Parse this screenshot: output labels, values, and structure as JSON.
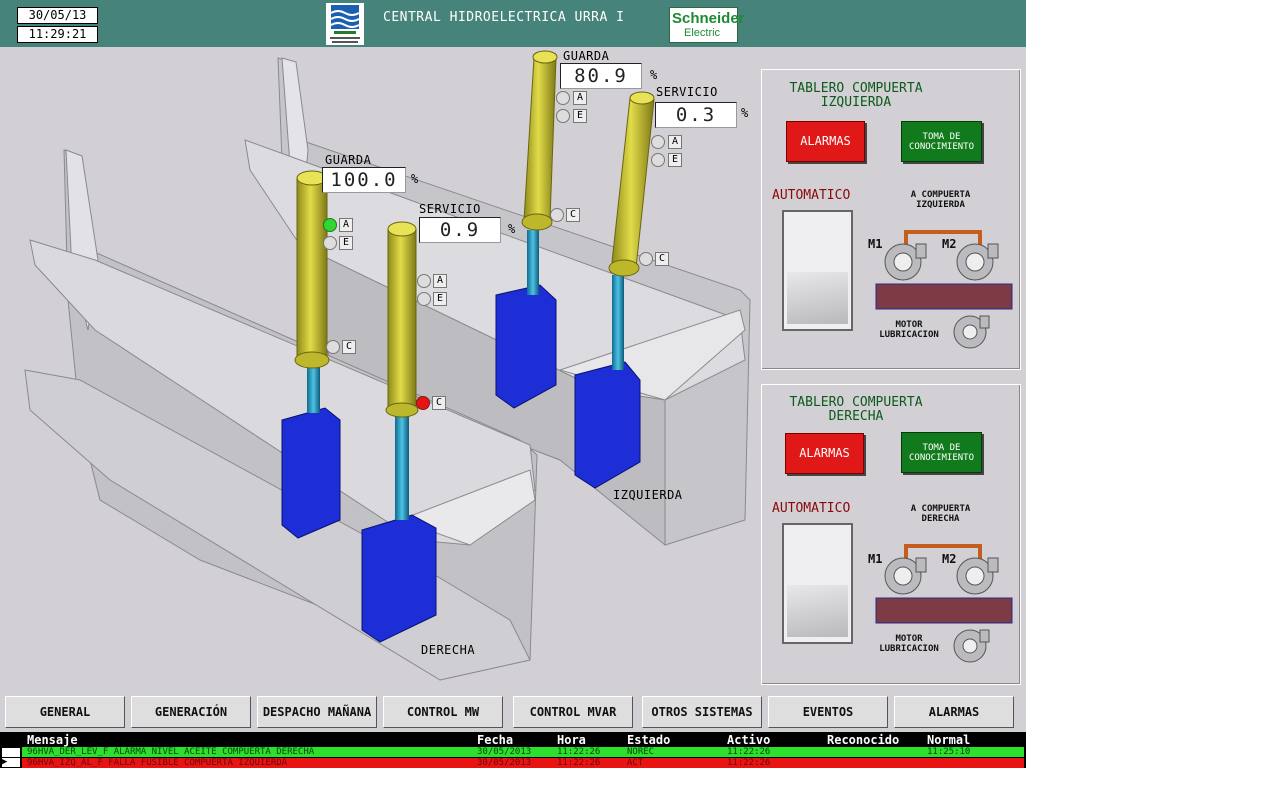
{
  "header": {
    "date": "30/05/13",
    "time": "11:29:21",
    "title": "CENTRAL HIDROELECTRICA URRA I",
    "logo_left_text": "EMPRESA URRA S.A. E.S.P.",
    "logo_right_text": [
      "Schneider",
      "Electric"
    ]
  },
  "gates": {
    "derecha_label": "DERECHA",
    "izquierda_label": "IZQUIERDA",
    "der_guarda": {
      "label": "GUARDA",
      "value": "100.0",
      "unit": "%",
      "ind_a": "A",
      "ind_e": "E",
      "ind_c": "C"
    },
    "der_servicio": {
      "label": "SERVICIO",
      "value": "0.9",
      "unit": "%",
      "ind_a": "A",
      "ind_e": "E",
      "ind_c": "C"
    },
    "izq_guarda": {
      "label": "GUARDA",
      "value": "80.9",
      "unit": "%",
      "ind_a": "A",
      "ind_e": "E",
      "ind_c": "C"
    },
    "izq_servicio": {
      "label": "SERVICIO",
      "value": "0.3",
      "unit": "%",
      "ind_a": "A",
      "ind_e": "E",
      "ind_c": "C"
    }
  },
  "panel_izq": {
    "title": "TABLERO COMPUERTA IZQUIERDA",
    "alarm_button": "ALARMAS",
    "ack_button": "TOMA DE CONOCIMIENTO",
    "mode": "AUTOMATICO",
    "target": "A COMPUERTA IZQUIERDA",
    "m1": "M1",
    "m2": "M2",
    "motor": "MOTOR LUBRICACION"
  },
  "panel_der": {
    "title": "TABLERO COMPUERTA DERECHA",
    "alarm_button": "ALARMAS",
    "ack_button": "TOMA DE CONOCIMIENTO",
    "mode": "AUTOMATICO",
    "target": "A COMPUERTA DERECHA",
    "m1": "M1",
    "m2": "M2",
    "motor": "MOTOR LUBRICACION"
  },
  "nav": [
    "GENERAL",
    "GENERACIÓN",
    "DESPACHO MAÑANA",
    "CONTROL MW",
    "CONTROL MVAR",
    "OTROS SISTEMAS",
    "EVENTOS",
    "ALARMAS"
  ],
  "alarms": {
    "headers": [
      "Mensaje",
      "Fecha",
      "Hora",
      "Estado",
      "Activo",
      "Reconocido",
      "Normal"
    ],
    "rows": [
      {
        "mensaje": "96HVA_DER_LEV_F ALARMA NIVEL ACEITE COMPUERTA DERECHA",
        "fecha": "30/05/2013",
        "hora": "11:22:26",
        "estado": "NOREC",
        "activo": "11:22:26",
        "reconocido": "",
        "normal": "11:25:10",
        "color": "#2ce02c"
      },
      {
        "mensaje": "96HVA_IZQ_AL_F FALLA FUSIBLE COMPUERTA IZQUIERDA",
        "fecha": "30/05/2013",
        "hora": "11:22:26",
        "estado": "ACT",
        "activo": "11:22:26",
        "reconocido": "",
        "normal": "",
        "color": "#e81414"
      }
    ]
  },
  "colors": {
    "header": "#46837b",
    "alarm_button": "#e01818",
    "ack_button": "#117a1c",
    "cylinder": "#c9c42e",
    "gate_body": "#1d2ed6"
  }
}
